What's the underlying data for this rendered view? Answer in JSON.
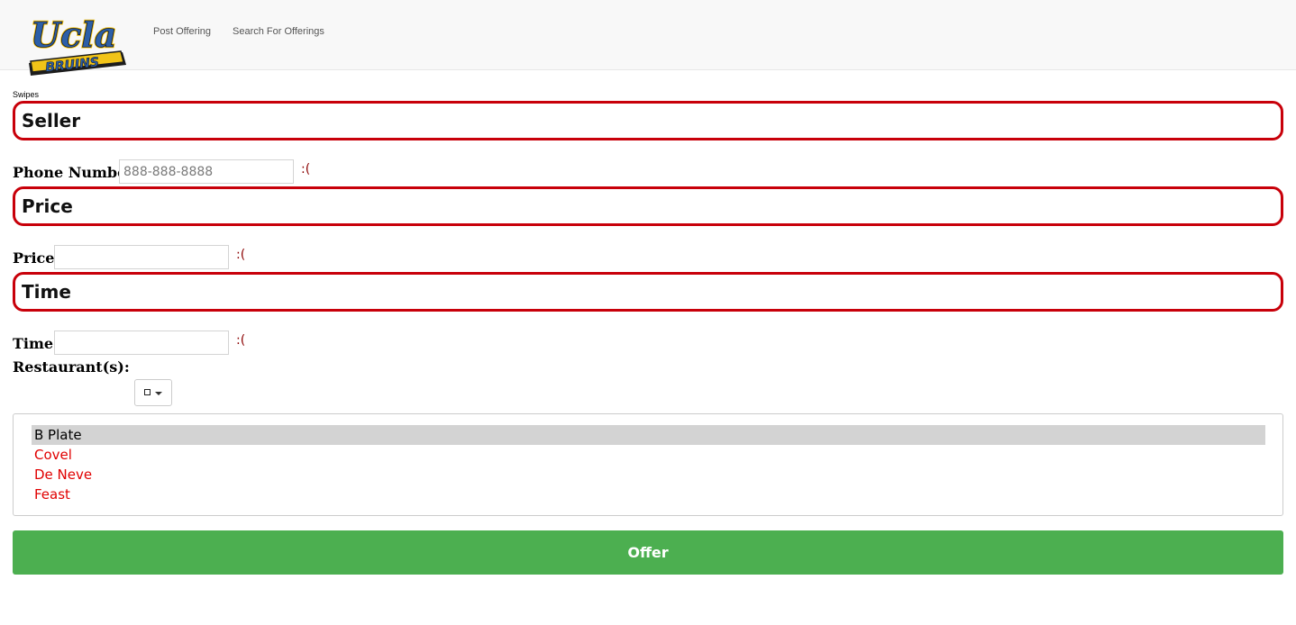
{
  "nav": {
    "logo_text": "Ucla",
    "logo_subtext": "BRUINS",
    "links": [
      "Post Offering",
      "Search For Offerings"
    ]
  },
  "page_label": "Swipes",
  "sections": {
    "seller": "Seller",
    "price": "Price",
    "time": "Time"
  },
  "fields": {
    "phone": {
      "label": "Phone Number:",
      "placeholder": "888-888-8888",
      "value": "",
      "status": ":("
    },
    "price": {
      "label": "Price:",
      "value": "",
      "status": ":("
    },
    "time": {
      "label": "Time:",
      "value": "",
      "status": ":("
    },
    "restaurants_label": "Restaurant(s):"
  },
  "restaurants": {
    "dropdown_icon": "checkbox-caret-icon",
    "items": [
      {
        "label": "B Plate",
        "selected": true
      },
      {
        "label": "Covel",
        "selected": false
      },
      {
        "label": "De Neve",
        "selected": false
      },
      {
        "label": "Feast",
        "selected": false
      }
    ]
  },
  "offer_button_label": "Offer",
  "colors": {
    "accent_red": "#c8000a",
    "offer_green": "#4caf50",
    "logo_blue": "#2c5fa8",
    "logo_gold": "#f2c418"
  }
}
